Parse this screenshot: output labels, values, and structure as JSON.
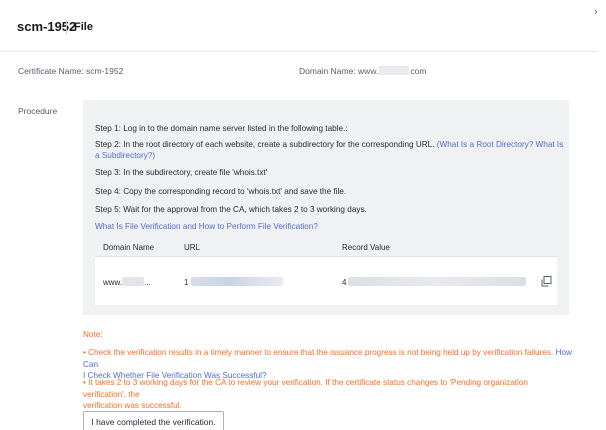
{
  "header": {
    "title": "scm-1952",
    "subtitle": "File",
    "close_icon": "chevron-right-icon"
  },
  "info": {
    "cert_label": "Certificate Name: scm-1952",
    "domain_prefix": "Domain Name: www.",
    "domain_suffix": "com"
  },
  "procedure_label": "Procedure",
  "steps": {
    "s1": "Step 1: Log in to the domain name server listed in the following table.:",
    "s2_text": "Step 2: In the root directory of each website, create a subdirectory for the corresponding URL.",
    "s2_link1": "(What Is a Root Directory?",
    "s2_link2a": "What Is a",
    "s2_link2b": "Subdirectory?)",
    "s3": "Step 3: In the subdirectory, create file 'whois.txt'",
    "s4": "Step 4: Copy the corresponding record to 'whois.txt' and save the file.",
    "s5": "Step 5: Wait for the approval from the CA, which takes 2 to 3 working days.",
    "help_link": "What Is File Verification and How to Perform File Verification?"
  },
  "table": {
    "headers": [
      "Domain Name",
      "URL",
      "Record Value"
    ],
    "row": {
      "domain_prefix": "www.",
      "domain_suffix": "...",
      "url_prefix": "1",
      "record_prefix": "4"
    },
    "copy_icon": "copy-icon"
  },
  "note": {
    "label": "Note:",
    "item1_text": "• Check the verification results in a timely manner to ensure that the issuance progress is not being held up by verification failures.",
    "item1_link1": "How Can",
    "item1_link2": "I Check Whether File Verification Was Successful?",
    "item2_line1": "• It takes 2 to 3 working days for the CA to review your verification. If the certificate status changes to 'Pending organization verification', the",
    "item2_line2": "verification was successful."
  },
  "button": {
    "done_label": "I have completed the verification."
  },
  "colors": {
    "link": "#526ecc",
    "note": "#f66f28",
    "panel_bg": "#f0f1f3"
  }
}
